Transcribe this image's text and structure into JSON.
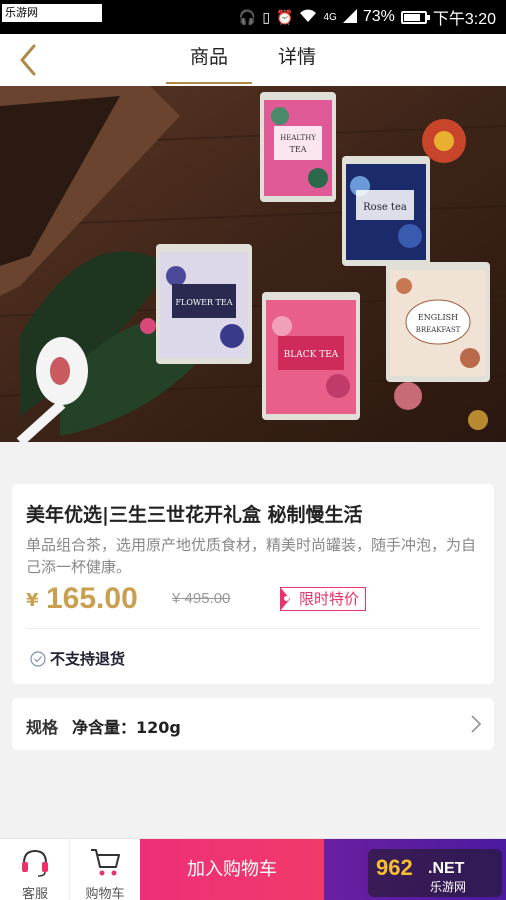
{
  "status_bar": {
    "watermark": "乐游网 www.962.net",
    "signal": "4G",
    "battery": "73%",
    "time": "下午3:20"
  },
  "nav": {
    "tabs": [
      {
        "label": "商品",
        "active": true
      },
      {
        "label": "详情",
        "active": false
      }
    ]
  },
  "hero": {
    "tins": [
      {
        "line1": "HEALTHY",
        "line2": "TEA"
      },
      {
        "line1": "Rose tea",
        "line2": ""
      },
      {
        "line1": "FLOWER TEA",
        "line2": ""
      },
      {
        "line1": "BLACK TEA",
        "line2": ""
      },
      {
        "line1": "ENGLISH",
        "line2": "BREAKFAST"
      }
    ]
  },
  "product": {
    "title": "美年优选|三生三世花开礼盒 秘制慢生活",
    "description": "单品组合茶，选用原产地优质食材，精美时尚罐装，随手冲泡，为自己添一杯健康。",
    "currency": "¥",
    "price": "165.00",
    "original_price": "¥ 495.00",
    "badge": "限时特价",
    "refund_note": "不支持退货"
  },
  "spec": {
    "label": "规格",
    "value": "净含量：120g"
  },
  "bottom_bar": {
    "service_label": "客服",
    "cart_label": "购物车",
    "add_to_cart": "加入购物车",
    "watermark_logo": "962.NET 乐游网"
  },
  "colors": {
    "accent_gold": "#c8a050",
    "tab_underline": "#b08a4a",
    "pink": "#e8336b",
    "purple": "#5a1fa0"
  }
}
